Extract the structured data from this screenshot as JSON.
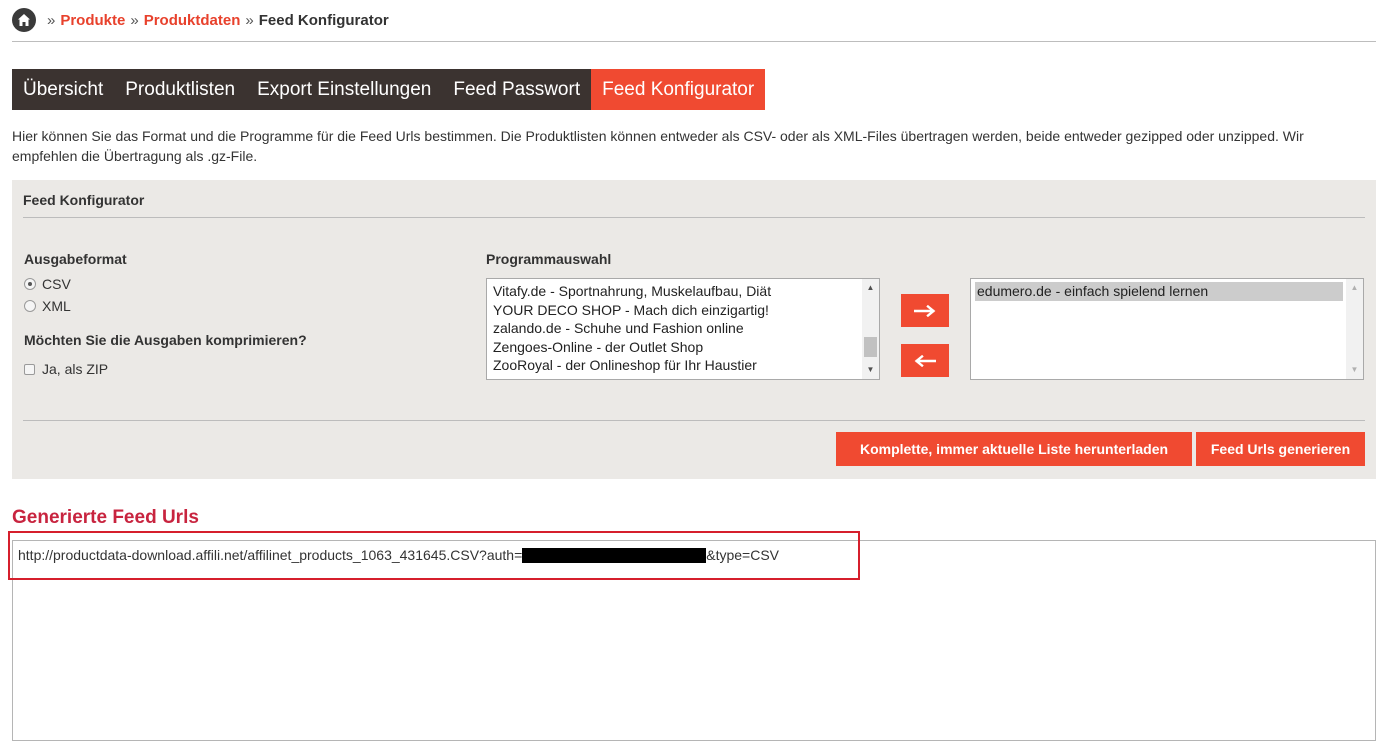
{
  "breadcrumb": {
    "home_icon": "home-icon",
    "separator": "»",
    "items": [
      "Produkte",
      "Produktdaten",
      "Feed Konfigurator"
    ]
  },
  "tabs": [
    {
      "label": "Übersicht",
      "active": false
    },
    {
      "label": "Produktlisten",
      "active": false
    },
    {
      "label": "Export Einstellungen",
      "active": false
    },
    {
      "label": "Feed Passwort",
      "active": false
    },
    {
      "label": "Feed Konfigurator",
      "active": true
    }
  ],
  "intro_text": "Hier können Sie das Format und die Programme für die Feed Urls bestimmen. Die Produktlisten können entweder als CSV- oder als XML-Files übertragen werden, beide entweder gezipped oder unzipped. Wir empfehlen die Übertragung als .gz-File.",
  "panel": {
    "title": "Feed Konfigurator",
    "output_format": {
      "label": "Ausgabeformat",
      "options": [
        {
          "label": "CSV",
          "selected": true
        },
        {
          "label": "XML",
          "selected": false
        }
      ]
    },
    "compress": {
      "question": "Möchten Sie die Ausgaben komprimieren?",
      "checkbox_label": "Ja, als ZIP",
      "checked": false
    },
    "program_selection": {
      "label": "Programmauswahl",
      "available": [
        "Vitafy.de - Sportnahrung, Muskelaufbau, Diät",
        "YOUR DECO SHOP - Mach dich einzigartig!",
        "zalando.de - Schuhe und Fashion online",
        "Zengoes-Online - der Outlet Shop",
        "ZooRoyal - der Onlineshop für Ihr Haustier"
      ],
      "selected": [
        "edumero.de - einfach spielend lernen"
      ],
      "add_icon": "arrow-right-icon",
      "remove_icon": "arrow-left-icon"
    },
    "buttons": {
      "download_label": "Komplette, immer aktuelle Liste herunterladen",
      "generate_label": "Feed Urls generieren"
    }
  },
  "generated": {
    "title": "Generierte Feed Urls",
    "url_prefix": "http://productdata-download.affili.net/affilinet_products_1063_431645.CSV?auth=",
    "url_suffix": "&type=CSV"
  },
  "colors": {
    "accent": "#f04a31",
    "tab_dark": "#3b3330",
    "section_title": "#c8243f",
    "panel_bg": "#ebe9e6",
    "highlight_border": "#d61f2c"
  }
}
